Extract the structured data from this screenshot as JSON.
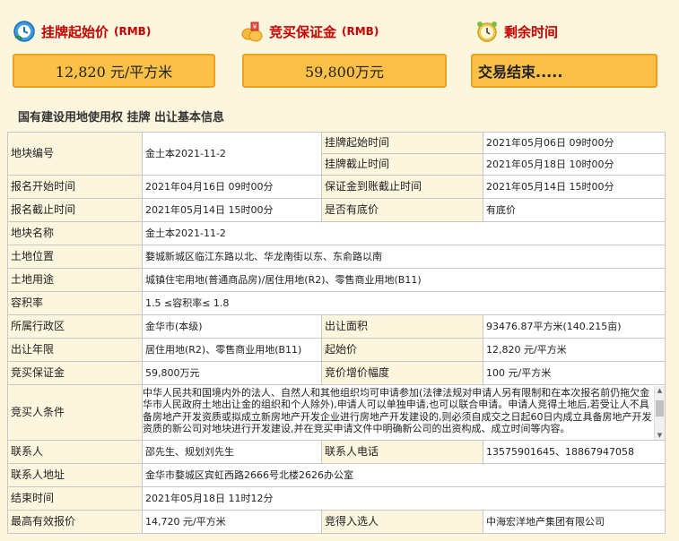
{
  "stats": {
    "start_price": {
      "title": "挂牌起始价",
      "unit": "(RMB)",
      "value": "12,820 元/平方米",
      "icon": "price-tag-icon"
    },
    "deposit": {
      "title": "竞买保证金",
      "unit": "(RMB)",
      "value": "59,800万元",
      "icon": "coins-icon"
    },
    "remaining": {
      "title": "剩余时间",
      "value": "交易结束.....",
      "icon": "alarm-clock-icon"
    }
  },
  "section_title": "国有建设用地使用权 挂牌 出让基本信息",
  "rows": {
    "plot_no_label": "地块编号",
    "plot_no": "金土本2021-11-2",
    "list_start_label": "挂牌起始时间",
    "list_start": "2021年05月06日 09时00分",
    "list_end_label": "挂牌截止时间",
    "list_end": "2021年05月18日 10时00分",
    "reg_start_label": "报名开始时间",
    "reg_start": "2021年04月16日 09时00分",
    "deposit_deadline_label": "保证金到账截止时间",
    "deposit_deadline": "2021年05月14日 15时00分",
    "reg_end_label": "报名截止时间",
    "reg_end": "2021年05月14日 15时00分",
    "reserve_label": "是否有底价",
    "reserve": "有底价",
    "plot_name_label": "地块名称",
    "plot_name": "金土本2021-11-2",
    "location_label": "土地位置",
    "location": "婺城新城区临江东路以北、华龙南街以东、东俞路以南",
    "usage_label": "土地用途",
    "usage": "城镇住宅用地(普通商品房)/居住用地(R2)、零售商业用地(B11)",
    "far_label": "容积率",
    "far": "1.5 ≤容积率≤ 1.8",
    "district_label": "所属行政区",
    "district": "金华市(本级)",
    "area_label": "出让面积",
    "area": "93476.87平方米(140.215亩)",
    "term_label": "出让年限",
    "term": "居住用地(R2)、零售商业用地(B11)",
    "start_price_label": "起始价",
    "start_price": "12,820 元/平方米",
    "deposit_label": "竞买保证金",
    "deposit": "59,800万元",
    "increment_label": "竞价增价幅度",
    "increment": "100 元/平方米",
    "conditions_label": "竞买人条件",
    "conditions": "中华人民共和国境内外的法人、自然人和其他组织均可申请参加(法律法规对申请人另有限制和在本次报名前仍拖欠金华市人民政府土地出让金的组织和个人除外),申请人可以单独申请,也可以联合申请。申请人竞得土地后,若受让人不具备房地产开发资质或拟成立新房地产开发企业进行房地产开发建设的,则必须自成交之日起60日内成立具备房地产开发资质的新公司对地块进行开发建设,并在竞买申请文件中明确新公司的出资构成、成立时间等内容。",
    "contact_label": "联系人",
    "contact": "邵先生、规划刘先生",
    "phone_label": "联系人电话",
    "phone": "13575901645、18867947058",
    "address_label": "联系人地址",
    "address": "金华市婺城区宾虹西路2666号北楼2626办公室",
    "end_time_label": "结束时间",
    "end_time": "2021年05月18日 11时12分",
    "highest_bid_label": "最高有效报价",
    "highest_bid": "14,720 元/平方米",
    "winner_label": "竞得入选人",
    "winner": "中海宏洋地产集团有限公司"
  },
  "colors": {
    "background": "#fdf6de",
    "accent_red": "#c40000",
    "box_fill": "#fbc048",
    "box_border": "#f0a020"
  }
}
